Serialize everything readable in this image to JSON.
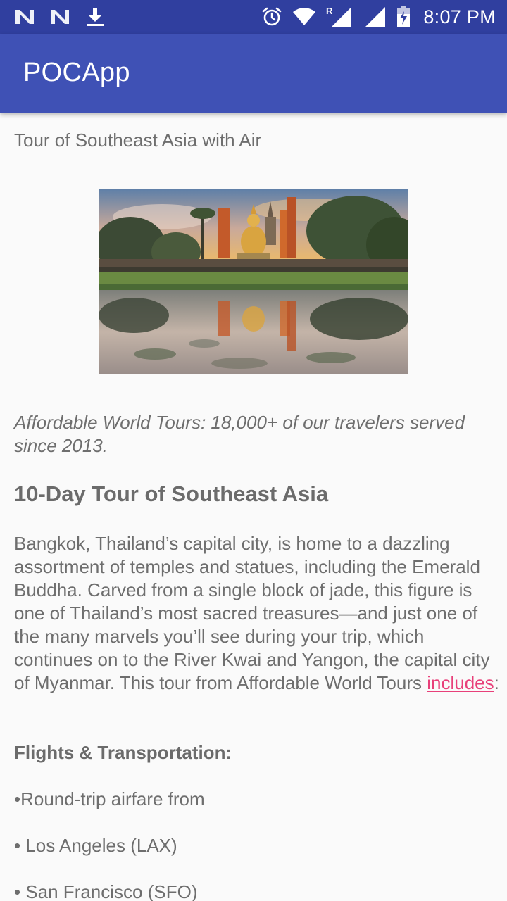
{
  "status_bar": {
    "time": "8:07 PM",
    "icons": [
      "n-notification-icon",
      "n-notification-icon",
      "download-icon",
      "alarm-icon",
      "wifi-icon",
      "signal-roaming-icon",
      "signal-icon",
      "battery-charging-icon"
    ],
    "roaming_label": "R"
  },
  "app_bar": {
    "title": "POCApp",
    "color": "#3f51b5",
    "status_color": "#303f9f"
  },
  "article": {
    "subtitle": "Tour of Southeast Asia with Air",
    "tagline": "Affordable World Tours: 18,000+ of our travelers served since 2013.",
    "heading": "10-Day Tour of Southeast Asia",
    "body_before_link": "Bangkok, Thailand’s capital city, is home to a dazzling assortment of temples and statues, including the Emerald Buddha. Carved from a single block of jade, this figure is one of Thailand’s most sacred treasures—and just one of the many marvels you’ll see during your trip, which continues on to the River Kwai and Yangon, the capital city of Myanmar. This tour from Affordable World Tours ",
    "link_text": "includes",
    "body_after_link": ":",
    "section_title": "Flights & Transportation:",
    "list": [
      "•Round-trip airfare from",
      "• Los Angeles (LAX)",
      "• San Francisco (SFO)"
    ],
    "link_color": "#e8407a"
  }
}
